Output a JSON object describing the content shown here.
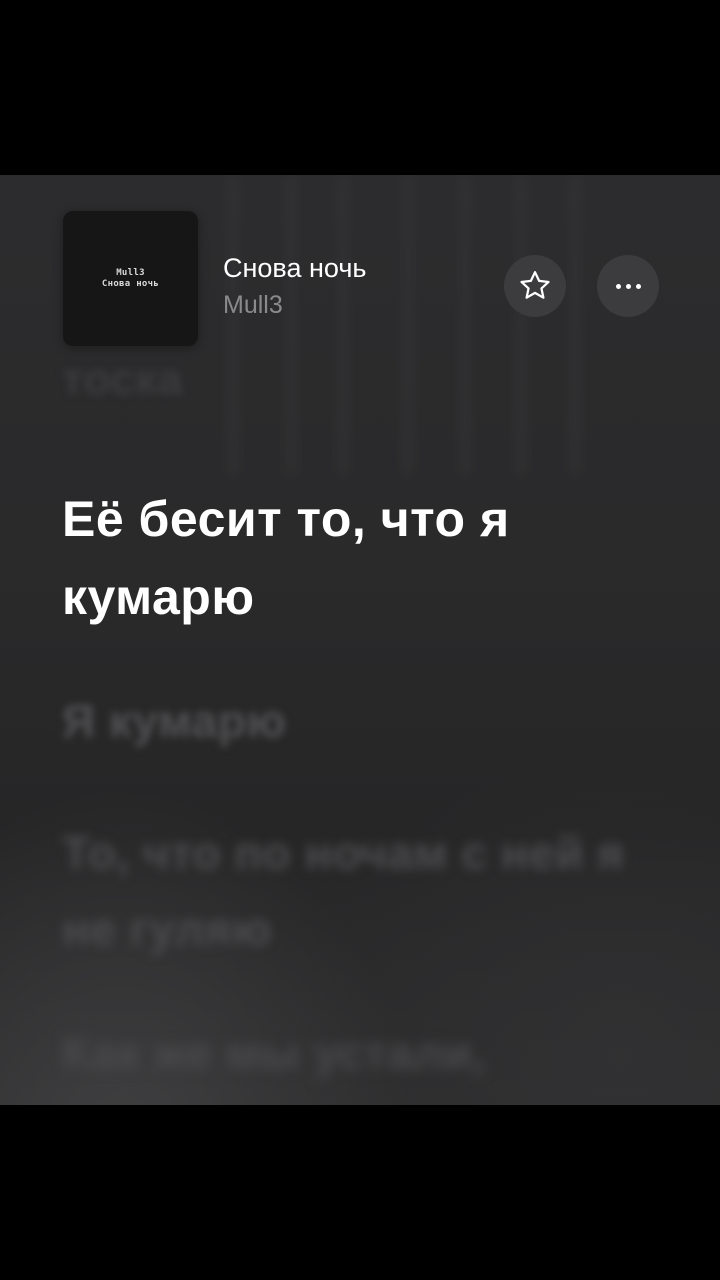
{
  "track": {
    "title": "Снова ночь",
    "artist": "Mull3",
    "cover_text_line1": "Mull3",
    "cover_text_line2": "Снова ночь"
  },
  "actions": {
    "favorite_icon": "star-outline-icon",
    "more_icon": "ellipsis-icon"
  },
  "lyrics": {
    "previous": "тоска",
    "current": "Её бесит то, что я кумарю",
    "next": [
      "Я кумарю",
      "То, что по ночам с ней я не гуляю",
      "Как же мы устали,"
    ]
  },
  "colors": {
    "background": "#2a2a2b",
    "current_line": "#ffffff",
    "upcoming_line": "#515153",
    "button_background": "#3c3c3e"
  }
}
